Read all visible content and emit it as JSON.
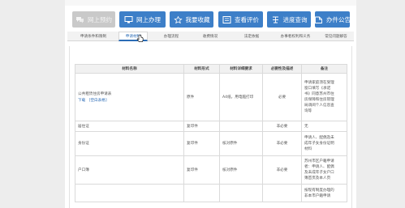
{
  "toolbar": {
    "buttons": [
      {
        "label": "网上预约",
        "icon": "chat-icon",
        "disabled": true
      },
      {
        "label": "网上办理",
        "icon": "monitor-icon",
        "disabled": false
      },
      {
        "label": "我要收藏",
        "icon": "star-icon",
        "disabled": false
      },
      {
        "label": "查看评价",
        "icon": "rating-icon",
        "disabled": false
      },
      {
        "label": "进度查询",
        "icon": "progress-icon",
        "disabled": false
      },
      {
        "label": "办件公告",
        "icon": "notice-icon",
        "disabled": false
      }
    ]
  },
  "tabs": [
    {
      "label": "申请条件和限制",
      "active": false
    },
    {
      "label": "申请材料",
      "active": true
    },
    {
      "label": "办理流程",
      "active": false
    },
    {
      "label": "收费情况",
      "active": false
    },
    {
      "label": "法定依据",
      "active": false
    },
    {
      "label": "办事者权利和义务",
      "active": false
    },
    {
      "label": "常见问题解答",
      "active": false
    }
  ],
  "table": {
    "headers": [
      "材料名称",
      "材料形式",
      "材料详细要求",
      "必要性及描述",
      "备注"
    ],
    "rows": [
      {
        "name": "公共租赁住房申请表",
        "link1": "下载",
        "link2": "[空白表格]",
        "form": "原件",
        "detail": "A4纸，用电脑打印",
        "necessity": "必要",
        "note": [
          "申请家庭须在受理",
          "窗口填写《承诺",
          "书》同意苏州市住",
          "房保障和住房管理",
          "局调阅个人信息查",
          "询等"
        ]
      },
      {
        "name": "居住证",
        "link1": "",
        "link2": "",
        "form": "复印件",
        "detail": "",
        "necessity": "非必要",
        "note": [
          "无"
        ]
      },
      {
        "name": "身份证",
        "link1": "",
        "link2": "",
        "form": "复印件",
        "detail": "核对原件",
        "necessity": "非必要",
        "note": [
          "申请人、配偶及未",
          "成年子女身份证明",
          "材料"
        ]
      },
      {
        "name": "户口簿",
        "link1": "",
        "link2": "",
        "form": "复印件",
        "detail": "核对原件",
        "necessity": "非必要",
        "note": [
          "苏州市区户籍申请",
          "者：申请人、配偶",
          "及未成年子女户口",
          "簿首页及本人页"
        ]
      },
      {
        "name": "",
        "link1": "",
        "link2": "",
        "form": "",
        "detail": "",
        "necessity": "",
        "note": [
          "按现有制度办理的",
          "非本市户籍申请"
        ]
      }
    ]
  }
}
